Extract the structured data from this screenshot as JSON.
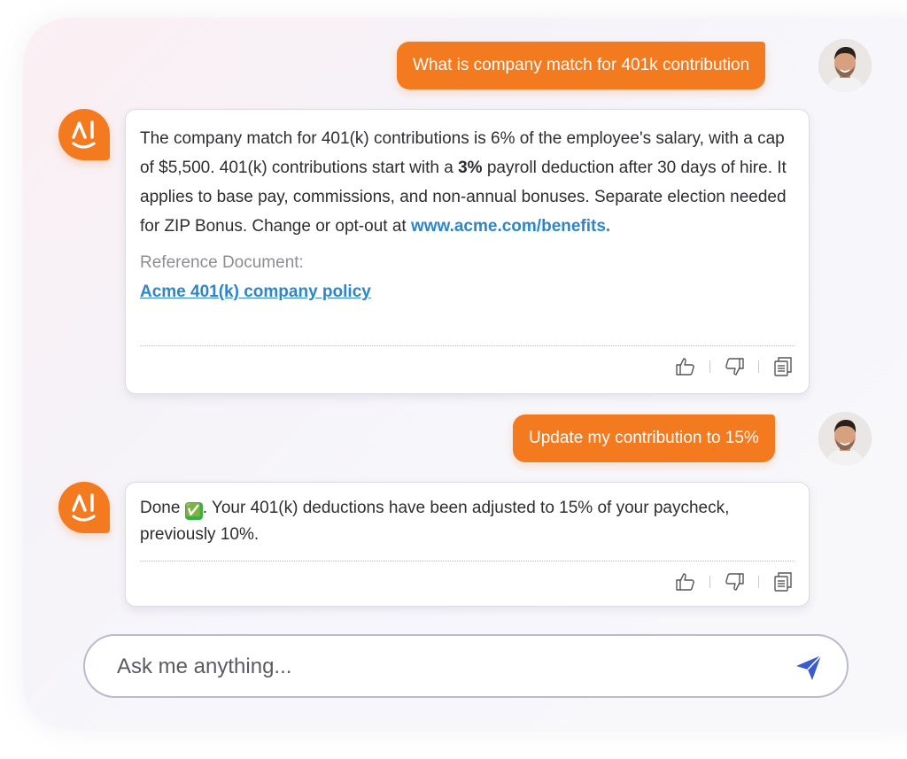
{
  "colors": {
    "accent": "#f47a20",
    "link": "#2e86c8",
    "send": "#3a5bd0"
  },
  "messages": [
    {
      "role": "user",
      "text": "What is company match for 401k contribution"
    },
    {
      "role": "assistant",
      "text_before_bold": "The company match for 401(k) contributions is 6% of the employee's salary, with a cap of $5,500. 401(k) contributions start with a ",
      "bold": "3%",
      "text_after_bold": " payroll deduction after 30 days of hire. It applies to base pay, commissions, and non-annual bonuses. Separate election needed for ZIP Bonus. Change or opt-out at ",
      "link": "www.acme.com/benefits.",
      "reference_label": "Reference Document:",
      "reference_link": "Acme 401(k) company policy",
      "actions": [
        "thumbs-up-icon",
        "thumbs-down-icon",
        "copy-icon"
      ]
    },
    {
      "role": "user",
      "text": "Update my contribution to 15%"
    },
    {
      "role": "assistant",
      "text_prefix": "Done ",
      "emoji": "✅",
      "text_suffix": ". Your 401(k) deductions have been adjusted to 15% of your paycheck, previously 10%.",
      "actions": [
        "thumbs-up-icon",
        "thumbs-down-icon",
        "copy-icon"
      ]
    }
  ],
  "input": {
    "placeholder": "Ask me anything...",
    "value": ""
  },
  "icons": {
    "logo": "ai-smile-logo-icon",
    "avatar": "user-avatar",
    "send": "paper-plane-icon"
  }
}
